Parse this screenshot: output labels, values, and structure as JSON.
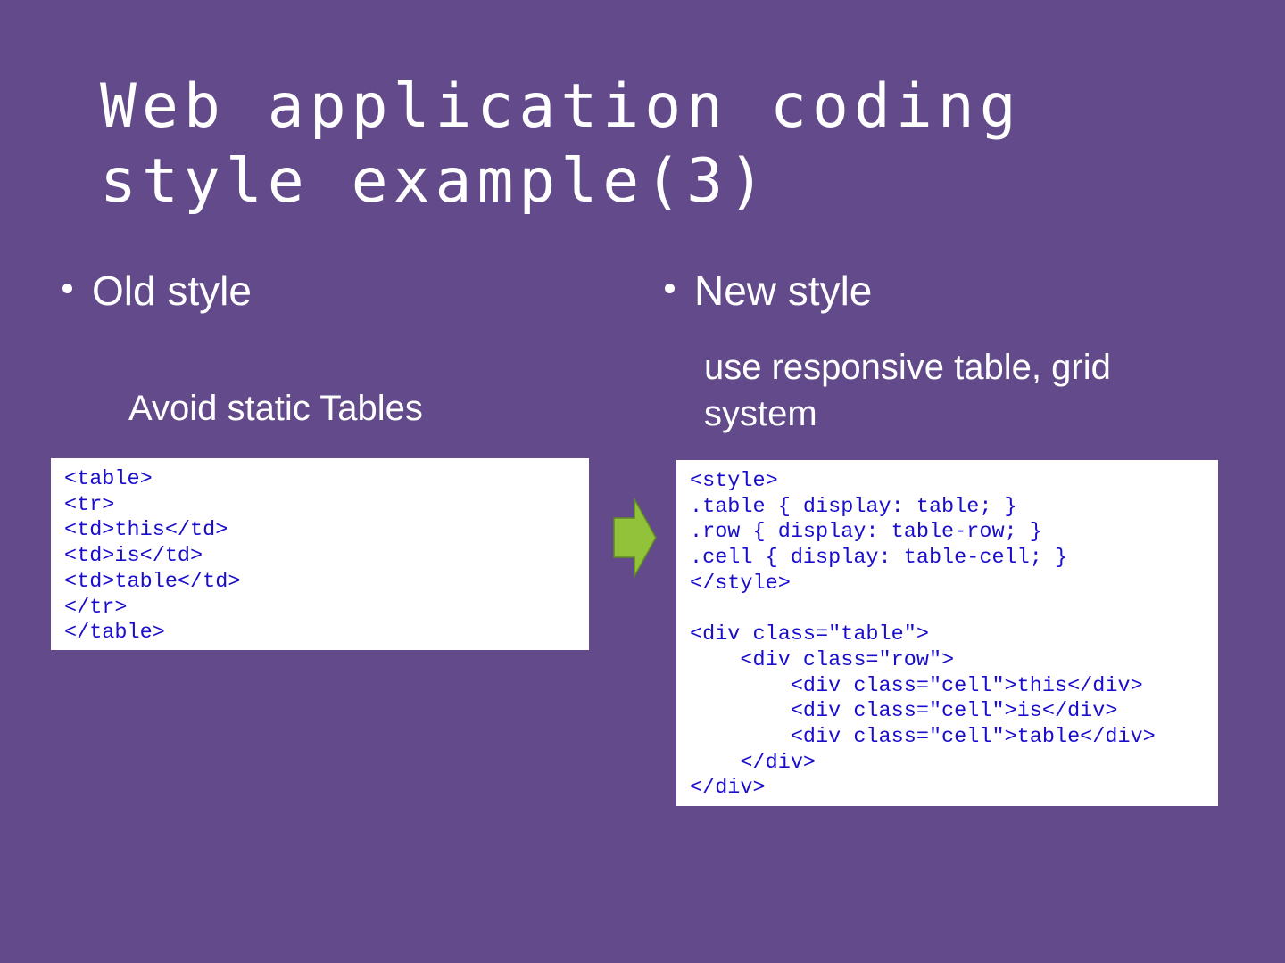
{
  "slide": {
    "title_lines": [
      "Web application coding",
      "style example(3)"
    ],
    "left": {
      "bullet": "Old style",
      "subtitle": "Avoid static Tables",
      "code_lines": [
        "<table>",
        "<tr>",
        "<td>this</td>",
        "<td>is</td>",
        "<td>table</td>",
        "</tr>",
        "</table>"
      ]
    },
    "right": {
      "bullet": "New style",
      "subtitle": "use responsive table, grid system",
      "code_lines": [
        "<style>",
        ".table { display: table; }",
        ".row { display: table-row; }",
        ".cell { display: table-cell; }",
        "</style>",
        "",
        "<div class=\"table\">",
        "    <div class=\"row\">",
        "        <div class=\"cell\">this</div>",
        "        <div class=\"cell\">is</div>",
        "        <div class=\"cell\">table</div>",
        "    </div>",
        "</div>"
      ]
    },
    "arrow_icon": "right-arrow-icon",
    "colors": {
      "background": "#634a8a",
      "text": "#ffffff",
      "code_text": "#1a0dcc",
      "code_background": "#ffffff",
      "arrow_fill": "#92c13a",
      "arrow_stroke": "#5f8a24"
    }
  }
}
